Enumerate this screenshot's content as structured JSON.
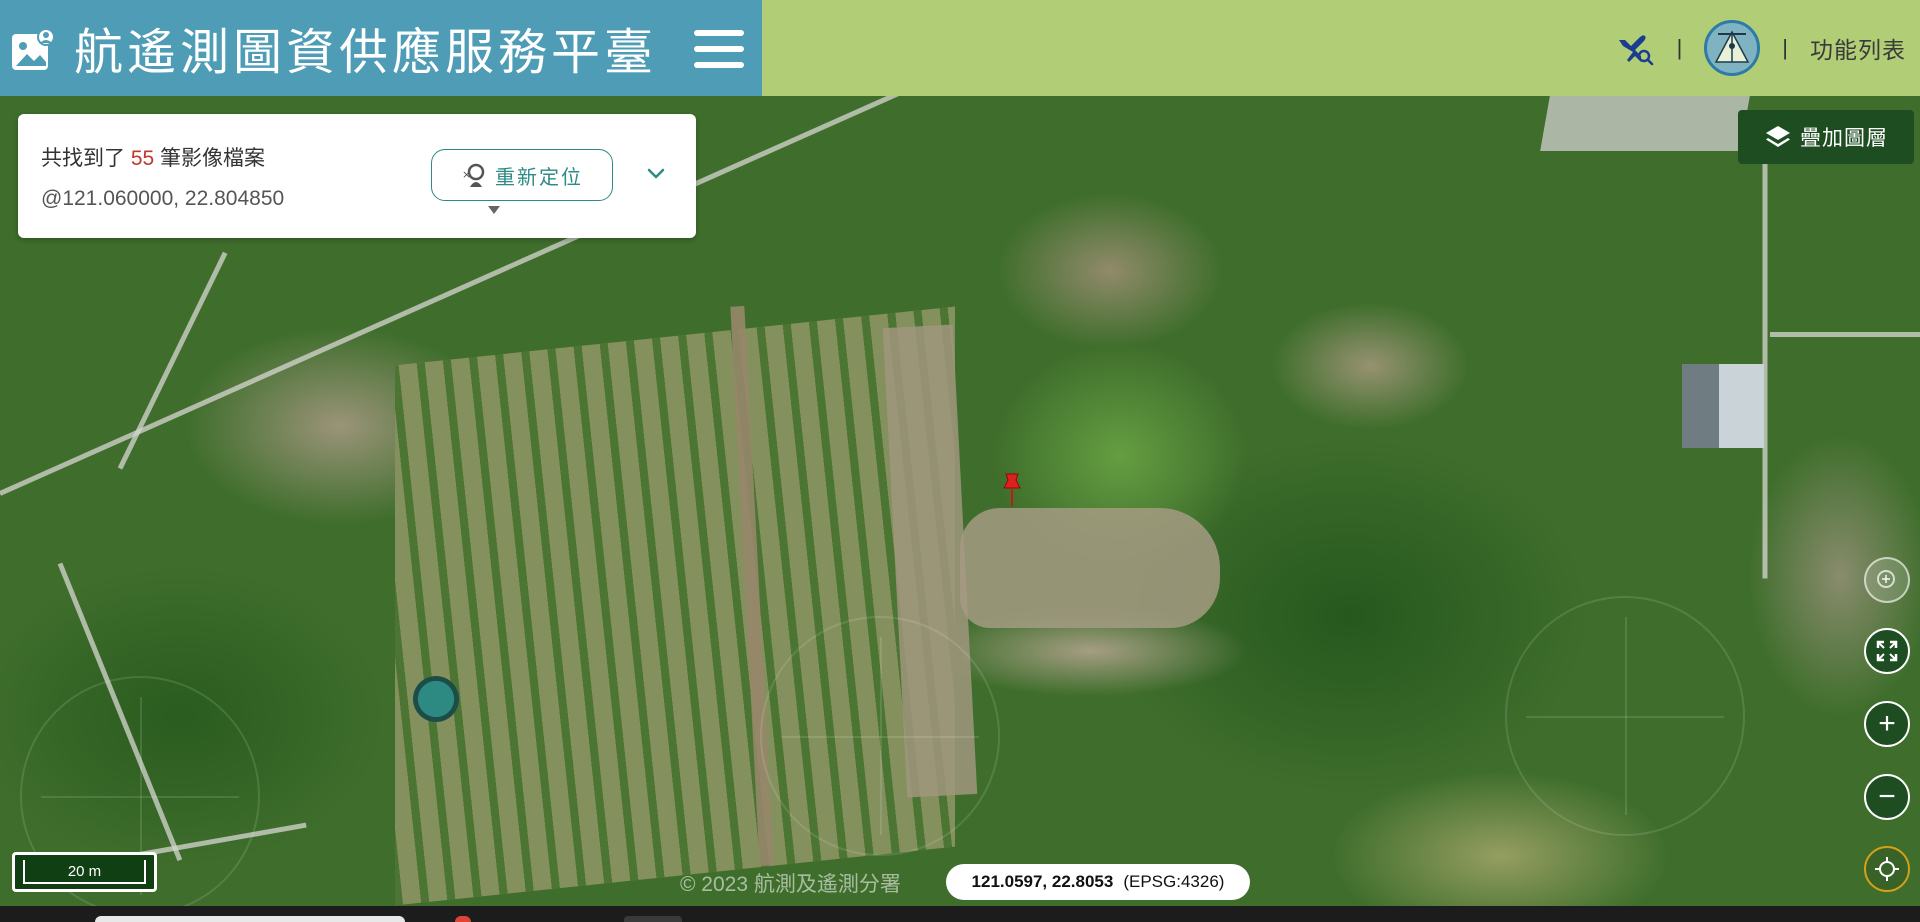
{
  "header": {
    "title": "航遙測圖資供應服務平臺",
    "menu_label": "功能列表",
    "separator": "|",
    "icons": {
      "brand": "image-user-icon",
      "hamburger": "hamburger-menu-icon",
      "flight_search": "airplane-search-icon",
      "agency_logo": "agency-logo-icon"
    }
  },
  "result_panel": {
    "prefix": "共找到了",
    "count": "55",
    "suffix": "筆影像檔案",
    "coordinates": "@121.060000, 22.804850",
    "relocate_label": "重新定位",
    "icons": {
      "relocate": "relocate-search-icon",
      "expand": "chevron-down-icon"
    }
  },
  "overlay_button": {
    "label": "疊加圖層",
    "icon": "layers-icon"
  },
  "map_controls": {
    "zoom_in_symbol": "+",
    "zoom_out_symbol": "−",
    "icons": [
      "zoom-search-icon",
      "fullscreen-icon",
      "zoom-in-icon",
      "zoom-out-icon",
      "locate-icon"
    ]
  },
  "map": {
    "marker_icon": "red-pushpin-icon",
    "scale_label": "20 m",
    "copyright": "© 2023 航測及遙測分署",
    "cursor_coords": "121.0597, 22.8053",
    "crs": "(EPSG:4326)"
  },
  "colors": {
    "brand_blue": "#4e9cb6",
    "header_green": "#b1cd76",
    "control_dark_green": "#1f4d22",
    "accent_teal": "#2e8a86",
    "count_red": "#c0392b"
  }
}
